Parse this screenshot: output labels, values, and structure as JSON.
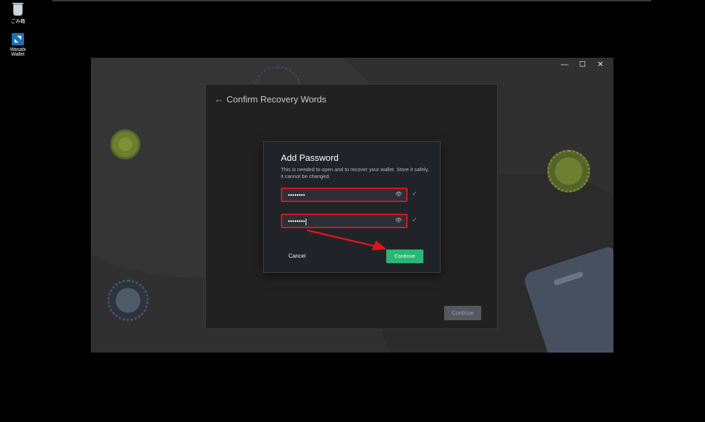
{
  "desktop": {
    "icons": [
      {
        "label": "ごみ箱",
        "icon": "recycle-bin-icon"
      },
      {
        "label": "Wasabi Wallet",
        "icon": "wasabi-wallet-icon"
      }
    ]
  },
  "window": {
    "controls": {
      "minimize": "—",
      "maximize": "☐",
      "close": "✕"
    },
    "wizard": {
      "back_glyph": "←",
      "title": "Confirm Recovery Words",
      "continue_label": "Continue"
    },
    "dialog": {
      "title": "Add Password",
      "description": "This is needed to open and to recover your wallet. Store it safely, it cannot be changed.",
      "password_value": "••••••••",
      "confirm_value": "••••••••",
      "eye_glyph": "👁",
      "check_glyph": "✓",
      "cancel_label": "Cancel",
      "continue_label": "Continue"
    }
  },
  "colors": {
    "accent_green": "#2bb673",
    "highlight_red": "#e0141b"
  }
}
